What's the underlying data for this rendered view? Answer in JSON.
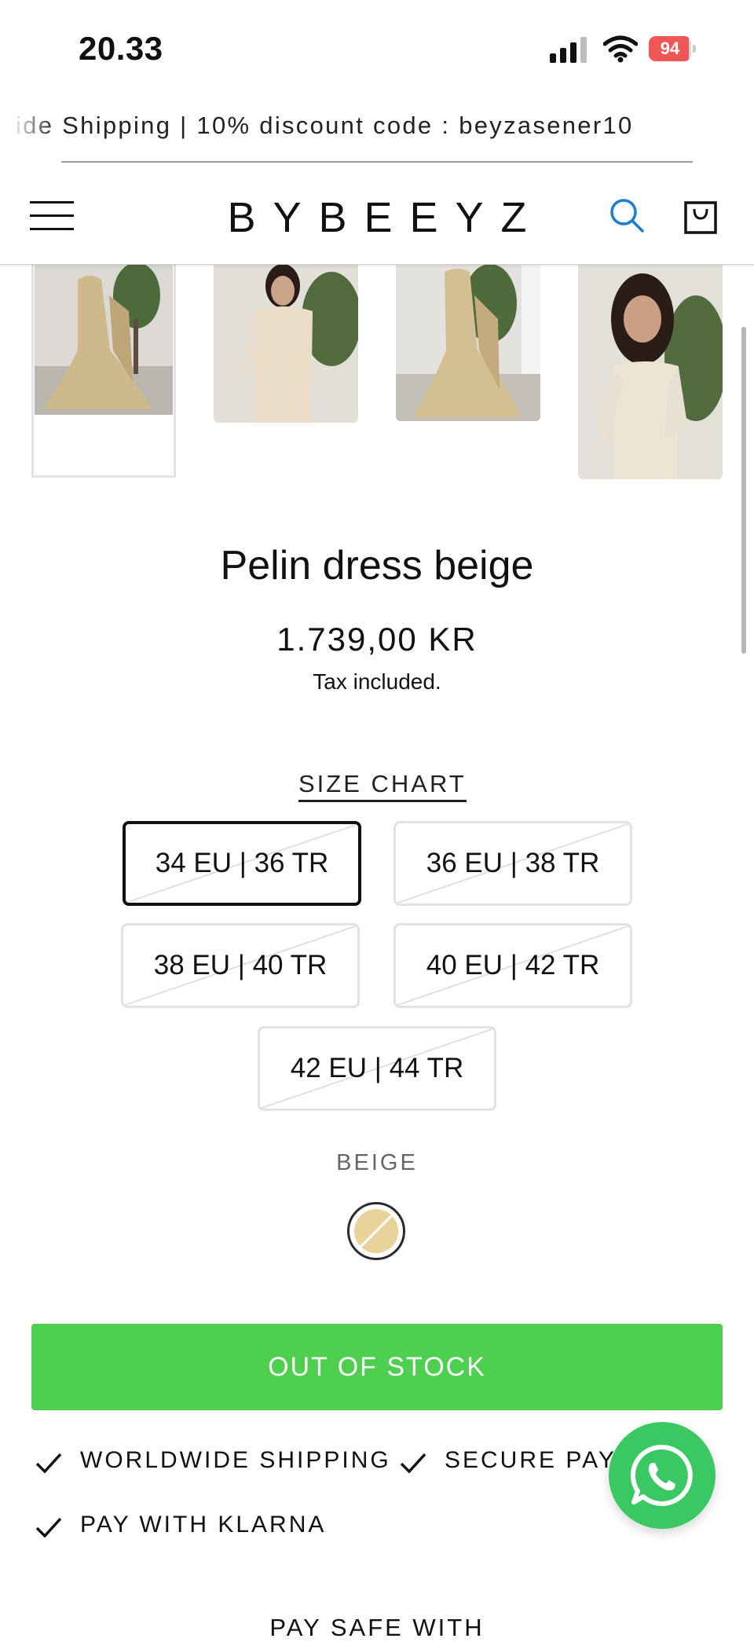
{
  "status_bar": {
    "time": "20.33",
    "battery": "94",
    "battery_level": 0.94,
    "icons": [
      "signal-icon",
      "wifi-icon",
      "battery-icon"
    ]
  },
  "announcement": {
    "text": "ide Shipping | 10% discount code : beyzasener10"
  },
  "header": {
    "logo": "BYBEEYZ",
    "icons": [
      "menu-icon",
      "search-icon",
      "cart-icon"
    ],
    "search_icon_color": "#1a7fd1"
  },
  "gallery": {
    "thumbnail_count": 4,
    "selected_index": 0
  },
  "product": {
    "title": "Pelin dress beige",
    "price": "1.739,00 KR",
    "tax_note": "Tax included.",
    "size_chart_label": "SIZE CHART",
    "sizes": [
      {
        "label": "34 EU | 36 TR",
        "selected": true,
        "available": false
      },
      {
        "label": "36 EU | 38 TR",
        "selected": false,
        "available": false
      },
      {
        "label": "38 EU | 40 TR",
        "selected": false,
        "available": false
      },
      {
        "label": "40 EU | 42 TR",
        "selected": false,
        "available": false
      },
      {
        "label": "42 EU | 44 TR",
        "selected": false,
        "available": false
      }
    ],
    "color_label": "BEIGE",
    "color_swatch": "#e8d39a",
    "button_label": "OUT OF STOCK",
    "button_color": "#4fcf4f"
  },
  "features": [
    {
      "label": "WORLDWIDE SHIPPING"
    },
    {
      "label": "SECURE PAYM"
    },
    {
      "label": "PAY WITH KLARNA"
    }
  ],
  "whatsapp": {
    "icon": "whatsapp-icon",
    "color": "#39c862"
  },
  "footer_heading": "PAY SAFE WITH"
}
